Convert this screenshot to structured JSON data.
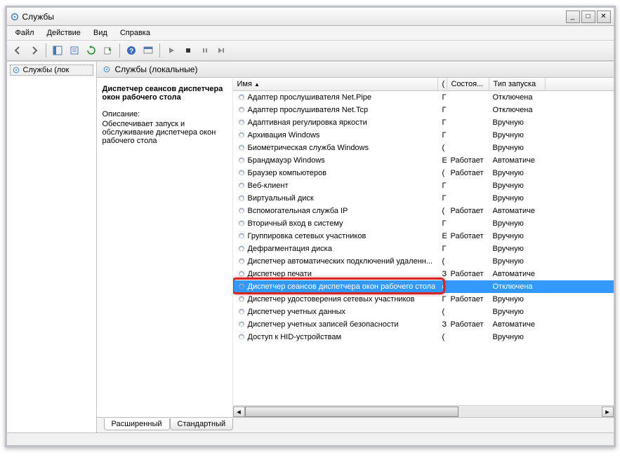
{
  "window": {
    "title": "Службы"
  },
  "menu": {
    "file": "Файл",
    "action": "Действие",
    "view": "Вид",
    "help": "Справка"
  },
  "tree": {
    "root": "Службы (лок"
  },
  "panel": {
    "header": "Службы (локальные)"
  },
  "detail": {
    "title": "Диспетчер сеансов диспетчера окон рабочего стола",
    "descLabel": "Описание:",
    "description": "Обеспечивает запуск и обслуживание диспетчера окон рабочего стола"
  },
  "columns": {
    "name": "Имя",
    "nameSort": "▲",
    "desc": "(",
    "status": "Состоя...",
    "startup": "Тип запуска"
  },
  "tabs": {
    "extended": "Расширенный",
    "standard": "Стандартный"
  },
  "services": [
    {
      "name": "Адаптер прослушивателя Net.Pipe",
      "desc": "Г",
      "status": "",
      "startup": "Отключена",
      "selected": false
    },
    {
      "name": "Адаптер прослушивателя Net.Tcp",
      "desc": "Г",
      "status": "",
      "startup": "Отключена",
      "selected": false
    },
    {
      "name": "Адаптивная регулировка яркости",
      "desc": "Г",
      "status": "",
      "startup": "Вручную",
      "selected": false
    },
    {
      "name": "Архивация Windows",
      "desc": "Г",
      "status": "",
      "startup": "Вручную",
      "selected": false
    },
    {
      "name": "Биометрическая служба Windows",
      "desc": "(",
      "status": "",
      "startup": "Вручную",
      "selected": false
    },
    {
      "name": "Брандмауэр Windows",
      "desc": "Е",
      "status": "Работает",
      "startup": "Автоматиче",
      "selected": false
    },
    {
      "name": "Браузер компьютеров",
      "desc": "(",
      "status": "Работает",
      "startup": "Вручную",
      "selected": false
    },
    {
      "name": "Веб-клиент",
      "desc": "Г",
      "status": "",
      "startup": "Вручную",
      "selected": false
    },
    {
      "name": "Виртуальный диск",
      "desc": "Г",
      "status": "",
      "startup": "Вручную",
      "selected": false
    },
    {
      "name": "Вспомогательная служба IP",
      "desc": "(",
      "status": "Работает",
      "startup": "Автоматиче",
      "selected": false
    },
    {
      "name": "Вторичный вход в систему",
      "desc": "Г",
      "status": "",
      "startup": "Вручную",
      "selected": false
    },
    {
      "name": "Группировка сетевых участников",
      "desc": "Е",
      "status": "Работает",
      "startup": "Вручную",
      "selected": false
    },
    {
      "name": "Дефрагментация диска",
      "desc": "Г",
      "status": "",
      "startup": "Вручную",
      "selected": false
    },
    {
      "name": "Диспетчер автоматических подключений удаленн...",
      "desc": "(",
      "status": "",
      "startup": "Вручную",
      "selected": false
    },
    {
      "name": "Диспетчер печати",
      "desc": "З",
      "status": "Работает",
      "startup": "Автоматиче",
      "selected": false
    },
    {
      "name": "Диспетчер сеансов диспетчера окон рабочего стола",
      "desc": "(",
      "status": "",
      "startup": "Отключена",
      "selected": true
    },
    {
      "name": "Диспетчер удостоверения сетевых участников",
      "desc": "Г",
      "status": "Работает",
      "startup": "Вручную",
      "selected": false
    },
    {
      "name": "Диспетчер учетных данных",
      "desc": "(",
      "status": "",
      "startup": "Вручную",
      "selected": false
    },
    {
      "name": "Диспетчер учетных записей безопасности",
      "desc": "З",
      "status": "Работает",
      "startup": "Автоматиче",
      "selected": false
    },
    {
      "name": "Доступ к HID-устройствам",
      "desc": "(",
      "status": "",
      "startup": "Вручную",
      "selected": false
    }
  ],
  "highlightRowIndex": 15
}
